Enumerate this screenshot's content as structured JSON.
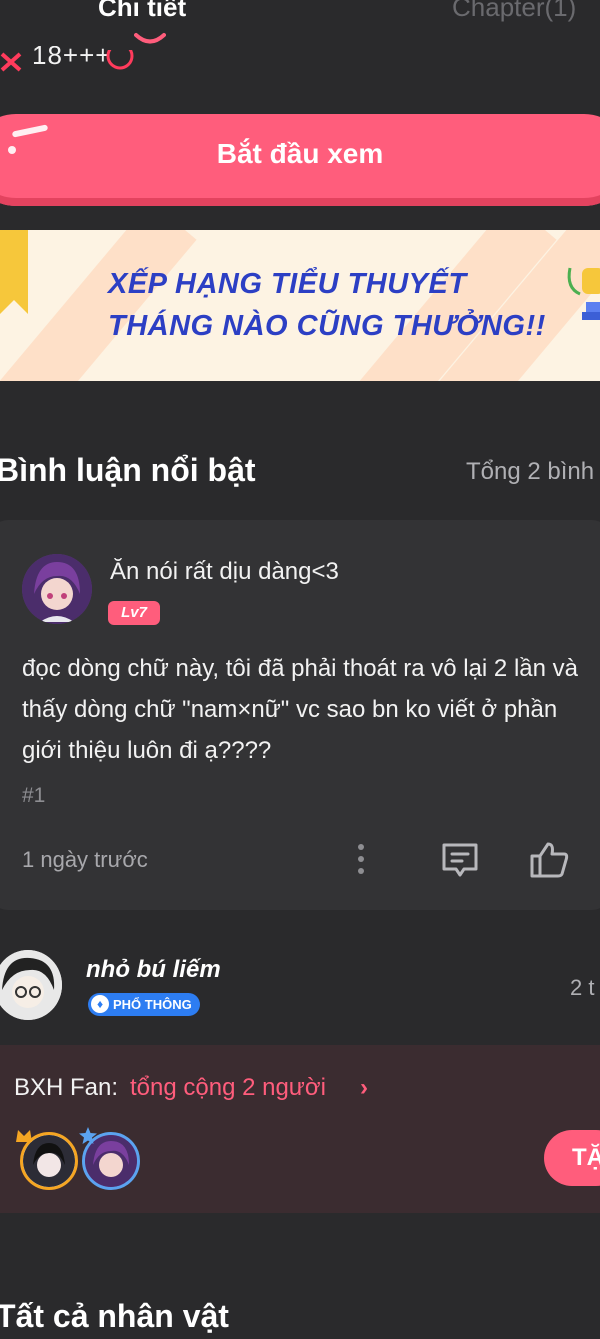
{
  "tabs": {
    "active": "Chi tiết",
    "inactive": "Chapter(1)"
  },
  "top_stats": {
    "value": "18+++"
  },
  "start_button": {
    "label": "Bắt đầu xem"
  },
  "banner": {
    "line1": "XẾP HẠNG TIỂU THUYẾT",
    "line2": "THÁNG NÀO CŨNG THƯỞNG!!"
  },
  "highlight_comments": {
    "title": "Bình luận nổi bật",
    "count": "Tổng 2 bình",
    "items": [
      {
        "name": "Ăn nói rất dịu dàng<3",
        "badge": "Lv7",
        "text": "đọc dòng chữ này, tôi đã phải thoát ra vô lại 2 lần và thấy dòng chữ \"nam×nữ\" vc sao bn ko viết ở phần giới thiệu luôn đi ạ????",
        "number": "#1",
        "time": "1 ngày trước"
      },
      {
        "name": "nhỏ bú liếm",
        "badge": "PHỔ THÔNG",
        "time": "2 t"
      }
    ]
  },
  "fan_rank": {
    "label": "BXH Fan:",
    "total": "tổng cộng 2 người",
    "chevron": "›",
    "button": "TẶ"
  },
  "characters": {
    "title": "Tất cả nhân vật"
  },
  "colors": {
    "accent": "#ff5d7c",
    "background": "#2a2a2c",
    "banner_text": "#2c3fc4",
    "badge_blue": "#2d7df2"
  }
}
